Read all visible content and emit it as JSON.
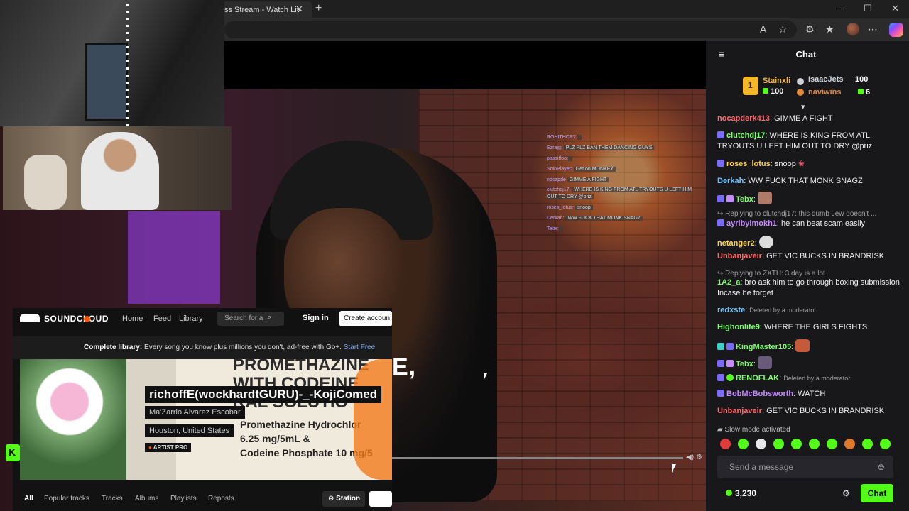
{
  "browser": {
    "tab_title": "ss Stream - Watch Liv",
    "tab_close": "✕",
    "new_tab": "+",
    "minimize": "—",
    "maximize": "☐",
    "close": "✕"
  },
  "video": {
    "subtitle": "E,",
    "overlay_chat": [
      {
        "user": "ROHITHCR7:",
        "text": ""
      },
      {
        "user": "Ezrajg:",
        "text": "PLZ PLZ BAN THEM DANCING GUYS"
      },
      {
        "user": "passitfoo:",
        "text": ""
      },
      {
        "user": "SoloPlayer:",
        "text": "Get on MONKEY"
      },
      {
        "user": "nocapde",
        "text": "GIMME A FIGHT"
      },
      {
        "user": "clutchdj17:",
        "text": "WHERE IS KING FROM ATL TRYOUTS U LEFT HIM OUT TO DRY @priz"
      },
      {
        "user": "roses_lotus:",
        "text": "snoop"
      },
      {
        "user": "Derkah:",
        "text": "WW FUCK THAT MONK SNAGZ"
      },
      {
        "user": "Tebx:",
        "text": ""
      }
    ]
  },
  "soundcloud": {
    "logo": "SOUNDCLOUD",
    "nav": {
      "home": "Home",
      "feed": "Feed",
      "library": "Library"
    },
    "search_placeholder": "Search for a",
    "sign_in": "Sign in",
    "create_account": "Create accoun",
    "banner_bold": "Complete library:",
    "banner_text": " Every song you know plus millions you don't, ad-free with Go+. ",
    "banner_link": "Start Free",
    "track_title": "richoffE(wockhardtGURU)-_-KojiComed",
    "artist": "Ma'Zarrio Alvarez Escobar",
    "location": "Houston, United States",
    "badge": "ARTIST PRO",
    "art_text_top": "PROMETHAZINE\nWITH CODEINE\nRAL SOLUTIO",
    "art_text_drug": "Promethazine Hydrochlor\n6.25 mg/5mL &\nCodeine Phosphate 10 mg/5",
    "tabs": [
      "All",
      "Popular tracks",
      "Tracks",
      "Albums",
      "Playlists",
      "Reposts"
    ],
    "station": "Station"
  },
  "chat": {
    "title": "Chat",
    "leaderboard": [
      {
        "name": "Stainxli",
        "value": "100",
        "color": "#f5b62a"
      },
      {
        "name": "IsaacJets",
        "value": "100",
        "color": "#cfd3d8"
      },
      {
        "name": "naviwins",
        "value": "6",
        "color": "#e08a3a"
      }
    ],
    "rank_one": "1",
    "messages": [
      {
        "user": "nocapderk413",
        "color": "#ff6b6b",
        "text": ": GIMME A FIGHT"
      },
      {
        "user": "clutchdj17",
        "color": "#7cff6b",
        "text": ": WHERE IS KING FROM ATL TRYOUTS U LEFT HIM OUT TO DRY @priz"
      },
      {
        "user": "roses_lotus",
        "color": "#ffd54a",
        "text": ": snoop"
      },
      {
        "user": "Derkah",
        "color": "#6ec8ff",
        "text": ": WW FUCK THAT MONK SNAGZ"
      },
      {
        "user": "Tebx",
        "color": "#7cff6b",
        "text": ":"
      },
      {
        "reply": "Replying to clutchdj17: this dumb Jew doesn't ..."
      },
      {
        "user": "ayribyimokh1",
        "color": "#c58bff",
        "text": ": he can beat scam easily"
      },
      {
        "user": "netanger2",
        "color": "#ffd54a",
        "text": ":"
      },
      {
        "user": "Unbanjaveir",
        "color": "#ff6b6b",
        "text": ": GET VIC BUCKS IN BRANDRISK"
      },
      {
        "reply": "Replying to ZXTH: 3 day is a lot"
      },
      {
        "user": "1A2_a",
        "color": "#7cff6b",
        "text": ": bro ask him to go through boxing submission Incase he forget"
      },
      {
        "user": "redxste",
        "color": "#6ec8ff",
        "deleted": "Deleted by a moderator"
      },
      {
        "user": "Highonlife9",
        "color": "#7cff6b",
        "text": ": WHERE THE GIRLS FIGHTS"
      },
      {
        "user": "KingMaster105",
        "color": "#7cff6b",
        "text": ":"
      },
      {
        "user": "Tebx",
        "color": "#7cff6b",
        "text": ":"
      },
      {
        "user": "RENOFLAK",
        "color": "#7cff6b",
        "deleted": "Deleted by a moderator"
      },
      {
        "user": "BobMcBobsworth",
        "color": "#c58bff",
        "text": ": WATCH"
      },
      {
        "user": "Unbanjaveir",
        "color": "#ff6b6b",
        "text": ": GET VIC BUCKS IN BRANDRISK"
      }
    ],
    "slow_mode": "Slow mode activated",
    "input_placeholder": "Send a message",
    "points": "3,230",
    "send_label": "Chat"
  },
  "colors": {
    "accent": "#53fc18",
    "panel": "#18181b",
    "soundcloud_orange": "#ff5500"
  }
}
